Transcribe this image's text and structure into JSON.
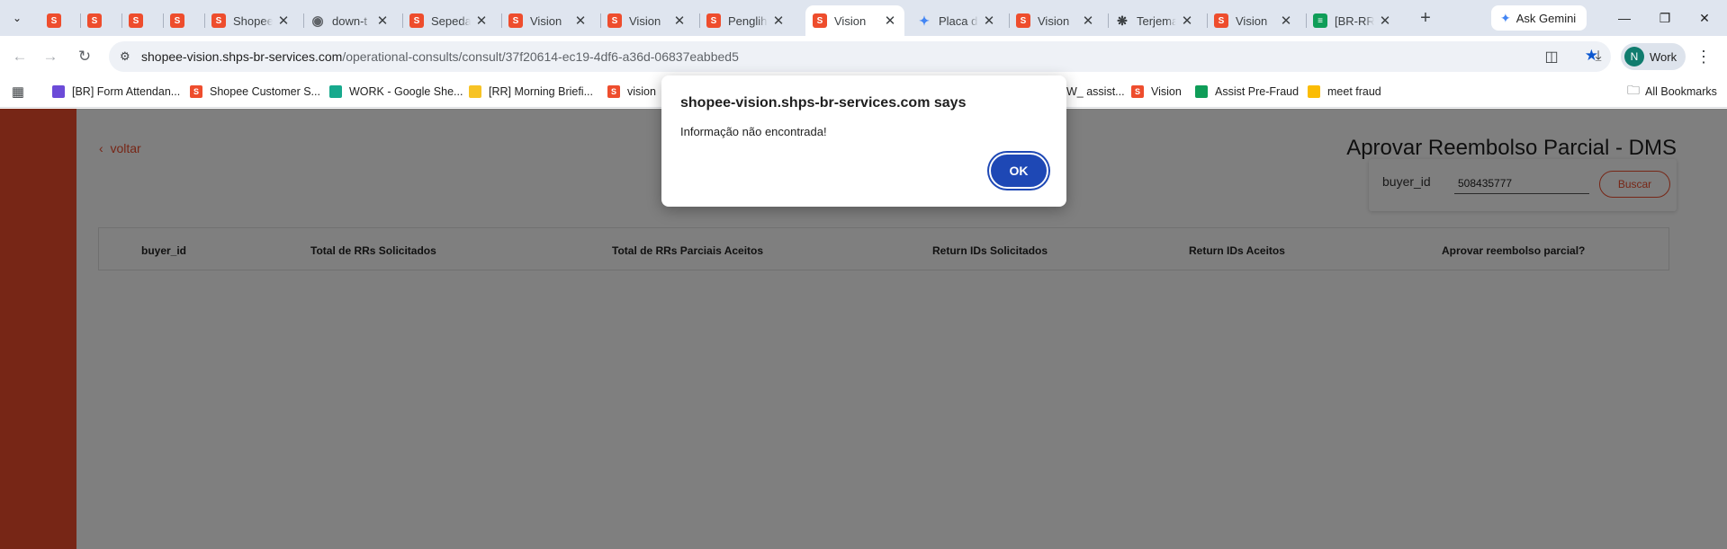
{
  "browser": {
    "tabs": [
      {
        "title": "",
        "icon": "shopee-icon"
      },
      {
        "title": "",
        "icon": "shopee-icon"
      },
      {
        "title": "",
        "icon": "shopee-icon"
      },
      {
        "title": "",
        "icon": "shopee-icon"
      },
      {
        "title": "Shopee",
        "icon": "shopee-icon"
      },
      {
        "title": "down-t",
        "icon": "globe-icon"
      },
      {
        "title": "Sepeda",
        "icon": "shopee-icon"
      },
      {
        "title": "Vision",
        "icon": "shopee-icon"
      },
      {
        "title": "Vision",
        "icon": "shopee-icon"
      },
      {
        "title": "Penglih",
        "icon": "shopee-icon"
      },
      {
        "title": "Vision",
        "icon": "shopee-icon",
        "active": true
      },
      {
        "title": "Placa de",
        "icon": "gemini-icon"
      },
      {
        "title": "Vision",
        "icon": "shopee-icon"
      },
      {
        "title": "Terjema",
        "icon": "chatgpt-icon"
      },
      {
        "title": "Vision",
        "icon": "shopee-icon"
      },
      {
        "title": "[BR-RR]",
        "icon": "sheets-icon"
      }
    ],
    "ask_gemini": "Ask Gemini",
    "url_host": "shopee-vision.shps-br-services.com",
    "url_path": "/operational-consults/consult/37f20614-ec19-4df6-a36d-06837eabbed5",
    "profile_initial": "N",
    "profile_name": "Work",
    "bookmarks": [
      {
        "label": "[BR] Form Attendan...",
        "icon": "purple"
      },
      {
        "label": "Shopee Customer S...",
        "icon": "shopee"
      },
      {
        "label": "WORK - Google She...",
        "icon": "teal"
      },
      {
        "label": "[RR] Morning Briefi...",
        "icon": "yellow"
      },
      {
        "label": "vision",
        "icon": "shopee"
      },
      {
        "label": "W_ assist...",
        "icon": "none"
      },
      {
        "label": "Vision",
        "icon": "shopee"
      },
      {
        "label": "Assist Pre-Fraud",
        "icon": "green"
      },
      {
        "label": "meet fraud",
        "icon": "meet"
      }
    ],
    "all_bookmarks": "All Bookmarks"
  },
  "page": {
    "back_label": "voltar",
    "title": "Aprovar Reembolso Parcial - DMS",
    "search": {
      "label": "buyer_id",
      "value": "508435777",
      "button": "Buscar"
    },
    "table": {
      "columns": [
        "buyer_id",
        "Total de RRs Solicitados",
        "Total de RRs Parciais Aceitos",
        "Return IDs Solicitados",
        "Return IDs Aceitos",
        "Aprovar reembolso parcial?"
      ]
    }
  },
  "dialog": {
    "title": "shopee-vision.shps-br-services.com says",
    "message": "Informação não encontrada!",
    "ok_label": "OK"
  },
  "colors": {
    "brand": "#ee4d2d",
    "dialog_button": "#1e48b5"
  }
}
